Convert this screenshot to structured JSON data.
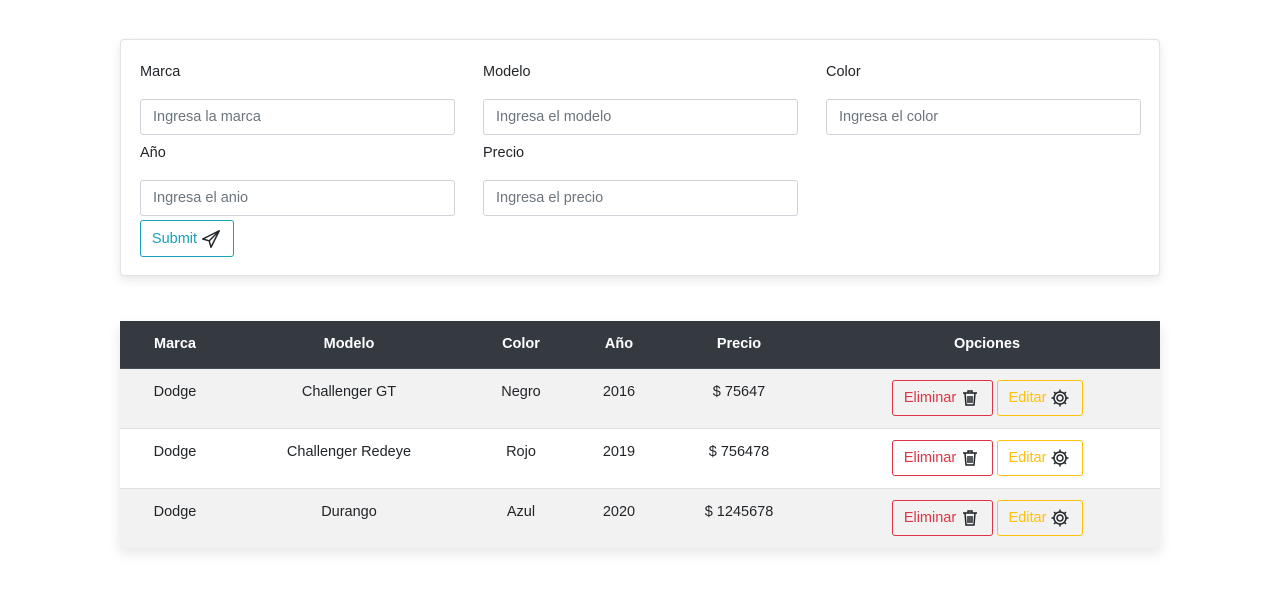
{
  "form": {
    "fields": [
      {
        "label": "Marca",
        "placeholder": "Ingresa la marca"
      },
      {
        "label": "Modelo",
        "placeholder": "Ingresa el modelo"
      },
      {
        "label": "Color",
        "placeholder": "Ingresa el color"
      },
      {
        "label": "Año",
        "placeholder": "Ingresa el anio"
      },
      {
        "label": "Precio",
        "placeholder": "Ingresa el precio"
      }
    ],
    "submit_label": "Submit",
    "submit_icon": "paper-plane-icon"
  },
  "table": {
    "headers": [
      "Marca",
      "Modelo",
      "Color",
      "Año",
      "Precio",
      "Opciones"
    ],
    "rows": [
      {
        "marca": "Dodge",
        "modelo": "Challenger GT",
        "color": "Negro",
        "anio": "2016",
        "precio": "$ 75647",
        "delete_label": "Eliminar",
        "edit_label": "Editar"
      },
      {
        "marca": "Dodge",
        "modelo": "Challenger Redeye",
        "color": "Rojo",
        "anio": "2019",
        "precio": "$ 756478",
        "delete_label": "Eliminar",
        "edit_label": "Editar"
      },
      {
        "marca": "Dodge",
        "modelo": "Durango",
        "color": "Azul",
        "anio": "2020",
        "precio": "$ 1245678",
        "delete_label": "Eliminar",
        "edit_label": "Editar"
      }
    ],
    "delete_icon": "trash-icon",
    "edit_icon": "gear-icon"
  },
  "colors": {
    "header_bg": "#343a40",
    "submit": "#17a2b8",
    "delete": "#dc3545",
    "edit": "#ffc107"
  }
}
